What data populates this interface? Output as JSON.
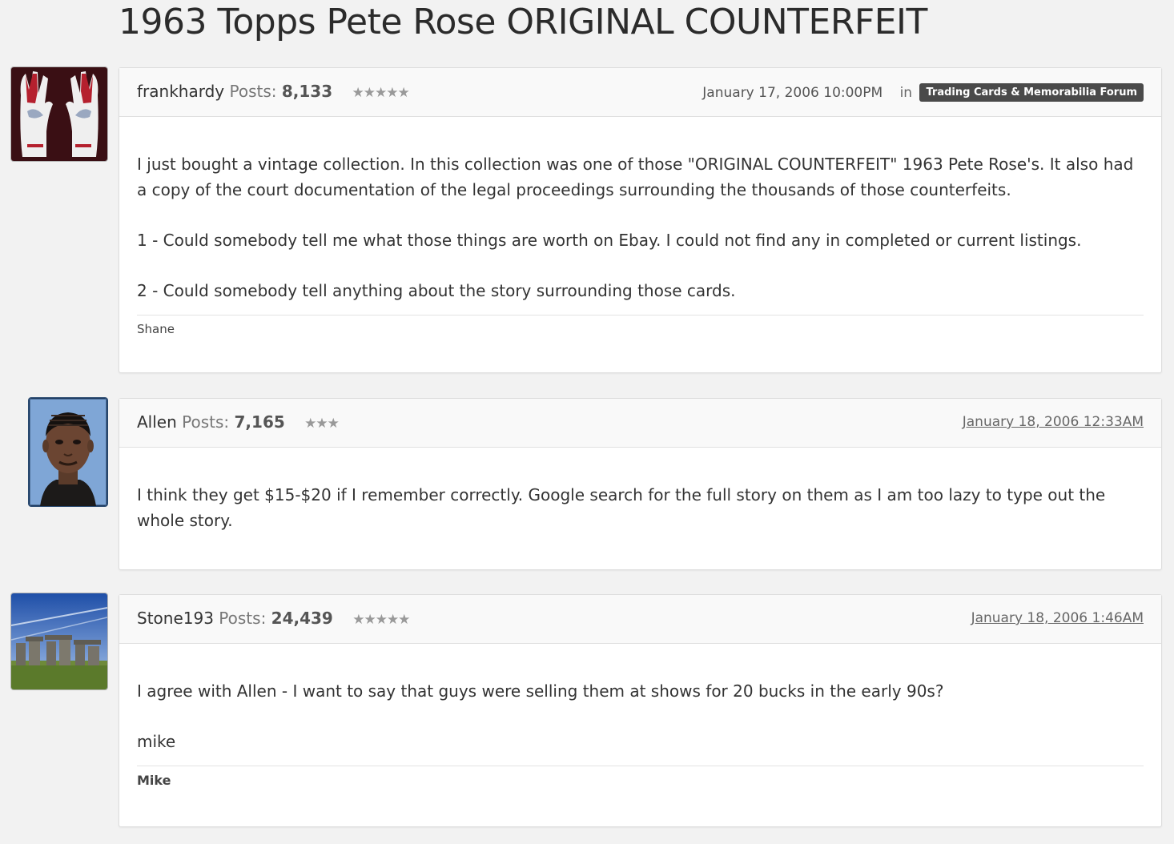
{
  "thread": {
    "title": "1963 Topps Pete Rose ORIGINAL COUNTERFEIT"
  },
  "posts": [
    {
      "author": "frankhardy",
      "posts_label": "Posts:",
      "post_count": "8,133",
      "stars": "★★★★★",
      "date": "January 17, 2006 10:00PM",
      "in_label": "in",
      "category": "Trading Cards & Memorabilia Forum",
      "paragraphs": [
        "I just bought a vintage collection. In this collection was one of those \"ORIGINAL COUNTERFEIT\" 1963 Pete Rose's. It also had a copy of the court documentation of the legal proceedings surrounding the thousands of those counterfeits.",
        "1 - Could somebody tell me what those things are worth on Ebay. I could not find any in completed or current listings.",
        "2 - Could somebody tell anything about the story surrounding those cards."
      ],
      "signature": "Shane"
    },
    {
      "author": "Allen",
      "posts_label": "Posts:",
      "post_count": "7,165",
      "stars": "★★★",
      "date": "January 18, 2006 12:33AM",
      "paragraphs": [
        "I think they get $15-$20 if I remember correctly. Google search for the full story on them as I am too lazy to type out the whole story."
      ]
    },
    {
      "author": "Stone193",
      "posts_label": "Posts:",
      "post_count": "24,439",
      "stars": "★★★★★",
      "date": "January 18, 2006 1:46AM",
      "paragraphs": [
        "I agree with Allen - I want to say that guys were selling them at shows for 20 bucks in the early 90s?",
        "mike"
      ],
      "signature": "Mike"
    }
  ]
}
